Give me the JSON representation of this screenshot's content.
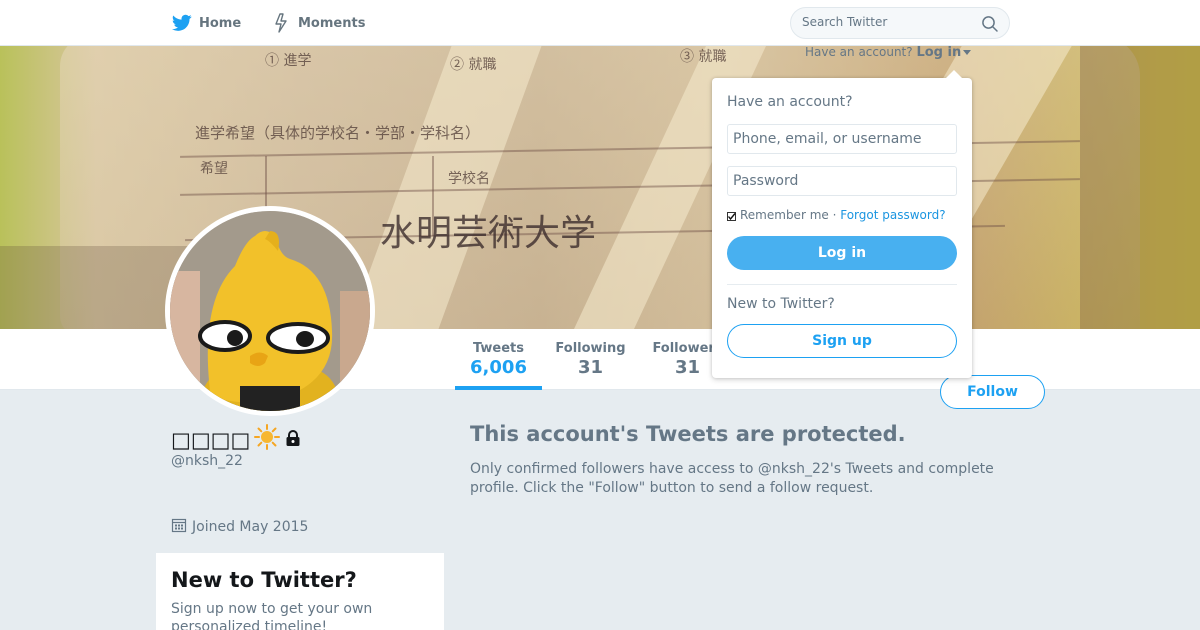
{
  "topnav": {
    "home_label": "Home",
    "moments_label": "Moments",
    "search_placeholder": "Search Twitter"
  },
  "login_link": {
    "prompt": "Have an account?",
    "label": "Log in"
  },
  "banner_text": {
    "line1_a": "① 進学",
    "line1_b": "② 就職",
    "line1_c": "③ 就職",
    "line2": "進学希望（具体的学校名・学部・学科名）",
    "line3_a": "希望",
    "line3_b": "学校名",
    "line4": "水明芸術大学"
  },
  "profile": {
    "name": "□□□□",
    "handle": "@nksh_22",
    "joined": "Joined May 2015"
  },
  "stats": [
    {
      "label": "Tweets",
      "value": "6,006"
    },
    {
      "label": "Following",
      "value": "31"
    },
    {
      "label": "Followers",
      "value": "31"
    }
  ],
  "follow_button": "Follow",
  "protected": {
    "title": "This account's Tweets are protected.",
    "text": "Only confirmed followers have access to @nksh_22's Tweets and complete profile. Click the \"Follow\" button to send a follow request."
  },
  "new_card": {
    "title": "New to Twitter?",
    "text": "Sign up now to get your own personalized timeline!"
  },
  "dropdown": {
    "heading": "Have an account?",
    "username_placeholder": "Phone, email, or username",
    "password_placeholder": "Password",
    "remember_label": "Remember me",
    "separator": " · ",
    "forgot_label": "Forgot password?",
    "login_button": "Log in",
    "new_heading": "New to Twitter?",
    "signup_button": "Sign up"
  },
  "colors": {
    "accent": "#1da1f2",
    "background": "#e6ecf0",
    "muted": "#657786"
  },
  "icons": [
    "twitter-bird-icon",
    "lightning-icon",
    "search-icon",
    "sun-emoji-icon",
    "lock-icon",
    "calendar-icon"
  ]
}
